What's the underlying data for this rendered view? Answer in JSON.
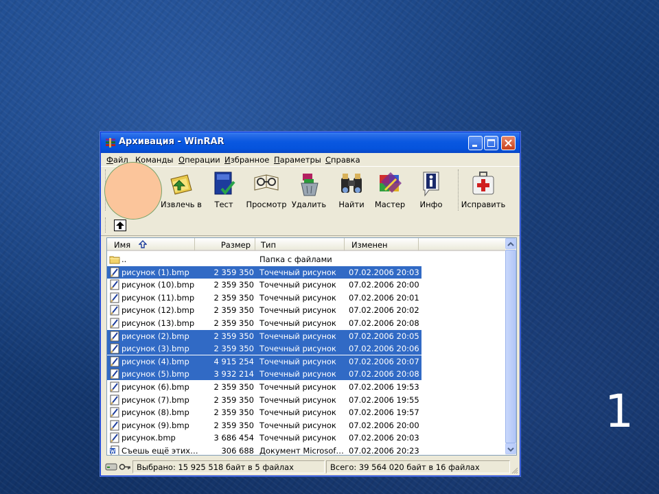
{
  "window": {
    "title": "Архивация - WinRAR",
    "controls": {
      "minimize": "minimize",
      "maximize": "maximize",
      "close": "close"
    }
  },
  "menu": [
    "Файл",
    "Команды",
    "Операции",
    "Избранное",
    "Параметры",
    "Справка"
  ],
  "toolbar": [
    {
      "label": "Извлечь в",
      "icon": "extract-icon"
    },
    {
      "label": "Тест",
      "icon": "test-icon"
    },
    {
      "label": "Просмотр",
      "icon": "view-icon"
    },
    {
      "label": "Удалить",
      "icon": "delete-icon"
    },
    {
      "label": "Найти",
      "icon": "find-icon"
    },
    {
      "label": "Мастер",
      "icon": "wizard-icon"
    },
    {
      "label": "Инфо",
      "icon": "info-icon"
    },
    {
      "label": "Исправить",
      "icon": "repair-icon"
    }
  ],
  "columns": {
    "name": "Имя",
    "size": "Размер",
    "type": "Тип",
    "modified": "Изменен"
  },
  "files": [
    {
      "name": "..",
      "size": "",
      "type": "Папка с файлами",
      "date": "",
      "icon": "folder-icon",
      "selected": false
    },
    {
      "name": "рисунок (1).bmp",
      "size": "2 359 350",
      "type": "Точечный рисунок",
      "date": "07.02.2006 20:03",
      "icon": "bmp-icon",
      "selected": true
    },
    {
      "name": "рисунок (10).bmp",
      "size": "2 359 350",
      "type": "Точечный рисунок",
      "date": "07.02.2006 20:00",
      "icon": "bmp-icon",
      "selected": false
    },
    {
      "name": "рисунок (11).bmp",
      "size": "2 359 350",
      "type": "Точечный рисунок",
      "date": "07.02.2006 20:01",
      "icon": "bmp-icon",
      "selected": false
    },
    {
      "name": "рисунок (12).bmp",
      "size": "2 359 350",
      "type": "Точечный рисунок",
      "date": "07.02.2006 20:02",
      "icon": "bmp-icon",
      "selected": false
    },
    {
      "name": "рисунок (13).bmp",
      "size": "2 359 350",
      "type": "Точечный рисунок",
      "date": "07.02.2006 20:08",
      "icon": "bmp-icon",
      "selected": false
    },
    {
      "name": "рисунок (2).bmp",
      "size": "2 359 350",
      "type": "Точечный рисунок",
      "date": "07.02.2006 20:05",
      "icon": "bmp-icon",
      "selected": true
    },
    {
      "name": "рисунок (3).bmp",
      "size": "2 359 350",
      "type": "Точечный рисунок",
      "date": "07.02.2006 20:06",
      "icon": "bmp-icon",
      "selected": true
    },
    {
      "name": "рисунок (4).bmp",
      "size": "4 915 254",
      "type": "Точечный рисунок",
      "date": "07.02.2006 20:07",
      "icon": "bmp-icon",
      "selected": true
    },
    {
      "name": "рисунок (5).bmp",
      "size": "3 932 214",
      "type": "Точечный рисунок",
      "date": "07.02.2006 20:08",
      "icon": "bmp-icon",
      "selected": true
    },
    {
      "name": "рисунок (6).bmp",
      "size": "2 359 350",
      "type": "Точечный рисунок",
      "date": "07.02.2006 19:53",
      "icon": "bmp-icon",
      "selected": false
    },
    {
      "name": "рисунок (7).bmp",
      "size": "2 359 350",
      "type": "Точечный рисунок",
      "date": "07.02.2006 19:55",
      "icon": "bmp-icon",
      "selected": false
    },
    {
      "name": "рисунок (8).bmp",
      "size": "2 359 350",
      "type": "Точечный рисунок",
      "date": "07.02.2006 19:57",
      "icon": "bmp-icon",
      "selected": false
    },
    {
      "name": "рисунок (9).bmp",
      "size": "2 359 350",
      "type": "Точечный рисунок",
      "date": "07.02.2006 20:00",
      "icon": "bmp-icon",
      "selected": false
    },
    {
      "name": "рисунок.bmp",
      "size": "3 686 454",
      "type": "Точечный рисунок",
      "date": "07.02.2006 20:03",
      "icon": "bmp-icon",
      "selected": false
    },
    {
      "name": "Съешь ещё этих…",
      "size": "306 688",
      "type": "Документ Microsof…",
      "date": "07.02.2006 20:23",
      "icon": "word-doc-icon",
      "selected": false
    }
  ],
  "status": {
    "selected": "Выбрано: 15 925 518 байт в 5 файлах",
    "total": "Всего: 39 564 020 байт в 16 файлах"
  },
  "slide_number": "1",
  "colors": {
    "selection": "#316ac5",
    "titlebar": "#0553dc",
    "window_bg": "#ece9d8",
    "slide_bg": "#163d78",
    "overlay_circle": "#fbc59b"
  }
}
